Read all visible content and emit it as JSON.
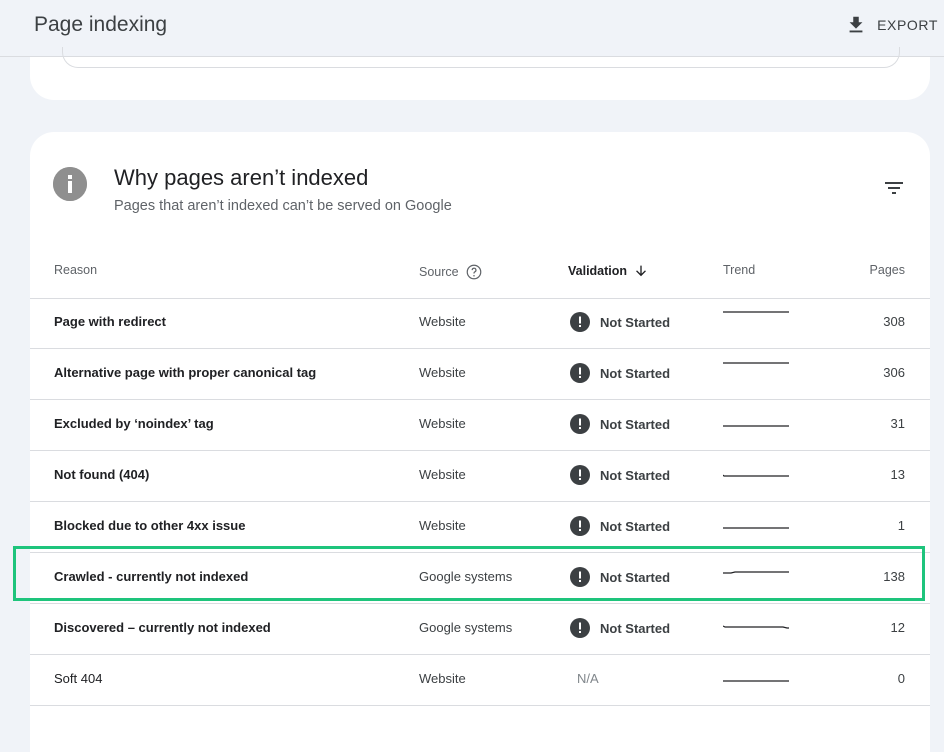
{
  "header": {
    "title": "Page indexing",
    "export_label": "EXPORT"
  },
  "card": {
    "title": "Why pages aren’t indexed",
    "subtitle": "Pages that aren’t indexed can’t be served on Google"
  },
  "table": {
    "columns": {
      "reason": "Reason",
      "source": "Source",
      "validation": "Validation",
      "trend": "Trend",
      "pages": "Pages"
    },
    "rows": [
      {
        "reason": "Page with redirect",
        "source": "Website",
        "validation": "Not Started",
        "pages": "308"
      },
      {
        "reason": "Alternative page with proper canonical tag",
        "source": "Website",
        "validation": "Not Started",
        "pages": "306"
      },
      {
        "reason": "Excluded by ‘noindex’ tag",
        "source": "Website",
        "validation": "Not Started",
        "pages": "31"
      },
      {
        "reason": "Not found (404)",
        "source": "Website",
        "validation": "Not Started",
        "pages": "13"
      },
      {
        "reason": "Blocked due to other 4xx issue",
        "source": "Website",
        "validation": "Not Started",
        "pages": "1"
      },
      {
        "reason": "Crawled - currently not indexed",
        "source": "Google systems",
        "validation": "Not Started",
        "pages": "138"
      },
      {
        "reason": "Discovered – currently not indexed",
        "source": "Google systems",
        "validation": "Not Started",
        "pages": "12"
      },
      {
        "reason": "Soft 404",
        "source": "Website",
        "validation": "N/A",
        "pages": "0"
      }
    ]
  },
  "colors": {
    "highlight": "#1ec47c",
    "alert": "#3c4043",
    "info": "#8f8f8f"
  }
}
